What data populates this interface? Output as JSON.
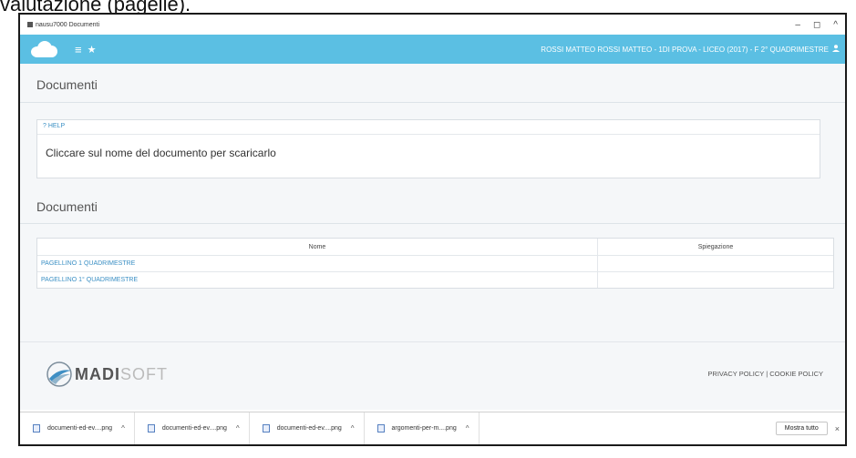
{
  "caption": "valutazione (pagelle).",
  "window": {
    "title": "nausu7000 Documenti",
    "controls": [
      "–",
      "◻",
      "^"
    ]
  },
  "appbar": {
    "menu_icon": "menu-icon",
    "star_icon": "star-icon",
    "user_info": "ROSSI MATTEO   ROSSI MATTEO - 1DI PROVA - LICEO (2017) - F   2° QUADRIMESTRE",
    "user_icon": "user-icon"
  },
  "page": {
    "title": "Documenti",
    "help": {
      "label": "? HELP",
      "text": "Cliccare sul nome del documento per scaricarlo"
    },
    "documents_title": "Documenti",
    "table": {
      "columns": [
        "Nome",
        "Spiegazione"
      ],
      "rows": [
        {
          "nome": "PAGELLINO 1 QUADRIMESTRE",
          "spiegazione": ""
        },
        {
          "nome": "PAGELLINO 1° QUADRIMESTRE",
          "spiegazione": ""
        }
      ]
    }
  },
  "footer": {
    "logo_bold": "MADI",
    "logo_light": "SOFT",
    "links": "PRIVACY POLICY | COOKIE POLICY"
  },
  "downloads": {
    "items": [
      "documenti-ed-ev....png",
      "documenti-ed-ev....png",
      "documenti-ed-ev....png",
      "argomenti-per-m....png"
    ],
    "show_all": "Mostra tutto",
    "close": "×"
  },
  "colors": {
    "accent": "#5bbfe3",
    "link": "#3a8fc4"
  }
}
